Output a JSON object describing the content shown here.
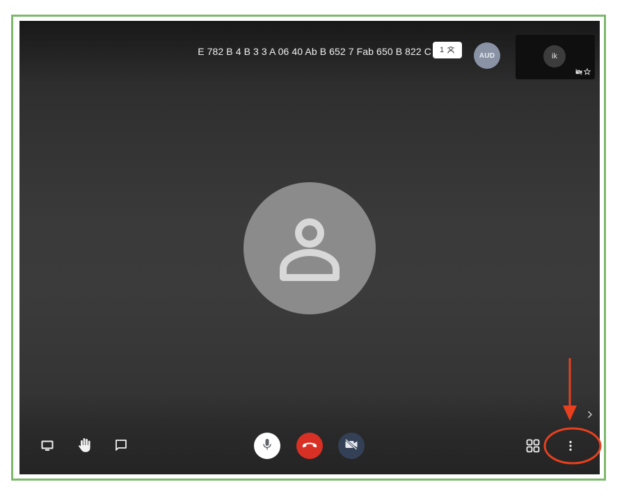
{
  "meeting": {
    "title": "E 782 B 4 B 3 3 A 06 40 Ab B 652 7 Fab 650 B 822 C",
    "participant_count": "1"
  },
  "participants": {
    "remote_avatar_label": "AUD",
    "self_avatar_initials": "ik"
  },
  "toolbar": {
    "left": [
      "present-screen",
      "raise-hand",
      "chat"
    ],
    "center": [
      "microphone",
      "end-call",
      "camera-off"
    ],
    "right": [
      "layout-grid",
      "more-options"
    ]
  },
  "colors": {
    "frame_border": "#7cb96b",
    "hangup": "#d93025",
    "camera_off_bg": "#344056",
    "avatar_bg": "#8b8b8b",
    "annotation": "#e8401e",
    "remote_avatar_bg": "#8a93a6"
  },
  "icons": {
    "participants": "people-icon",
    "self_status": [
      "camera-off-icon",
      "pin-star-icon"
    ],
    "main_avatar": "person-icon",
    "side_panel": "chevron-right-icon"
  }
}
